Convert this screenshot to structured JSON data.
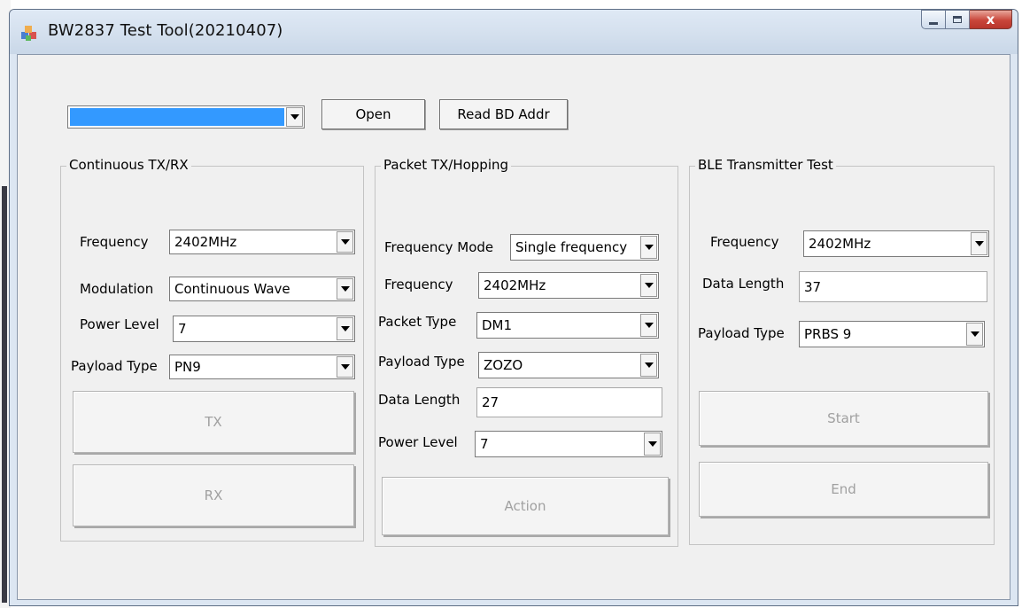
{
  "window": {
    "title": "BW2837 Test Tool(20210407)",
    "close_glyph": "x",
    "icon": "app-blocks-icon"
  },
  "toolbar": {
    "port_select_value": "",
    "open_label": "Open",
    "read_bd_addr_label": "Read BD Addr"
  },
  "continuous": {
    "title": "Continuous TX/RX",
    "frequency_label": "Frequency",
    "frequency_value": "2402MHz",
    "modulation_label": "Modulation",
    "modulation_value": "Continuous Wave",
    "power_level_label": "Power Level",
    "power_level_value": "7",
    "payload_type_label": "Payload Type",
    "payload_type_value": "PN9",
    "tx_label": "TX",
    "rx_label": "RX"
  },
  "packet": {
    "title": "Packet TX/Hopping",
    "frequency_mode_label": "Frequency Mode",
    "frequency_mode_value": "Single frequency",
    "frequency_label": "Frequency",
    "frequency_value": "2402MHz",
    "packet_type_label": "Packet Type",
    "packet_type_value": "DM1",
    "payload_type_label": "Payload Type",
    "payload_type_value": "ZOZO",
    "data_length_label": "Data Length",
    "data_length_value": "27",
    "power_level_label": "Power Level",
    "power_level_value": "7",
    "action_label": "Action"
  },
  "ble": {
    "title": "BLE Transmitter Test",
    "frequency_label": "Frequency",
    "frequency_value": "2402MHz",
    "data_length_label": "Data Length",
    "data_length_value": "37",
    "payload_type_label": "Payload Type",
    "payload_type_value": "PRBS 9",
    "start_label": "Start",
    "end_label": "End"
  },
  "colors": {
    "selection": "#3399ff",
    "disabled_text": "#a0a0a0",
    "dialog_bg": "#f0f0f0"
  }
}
